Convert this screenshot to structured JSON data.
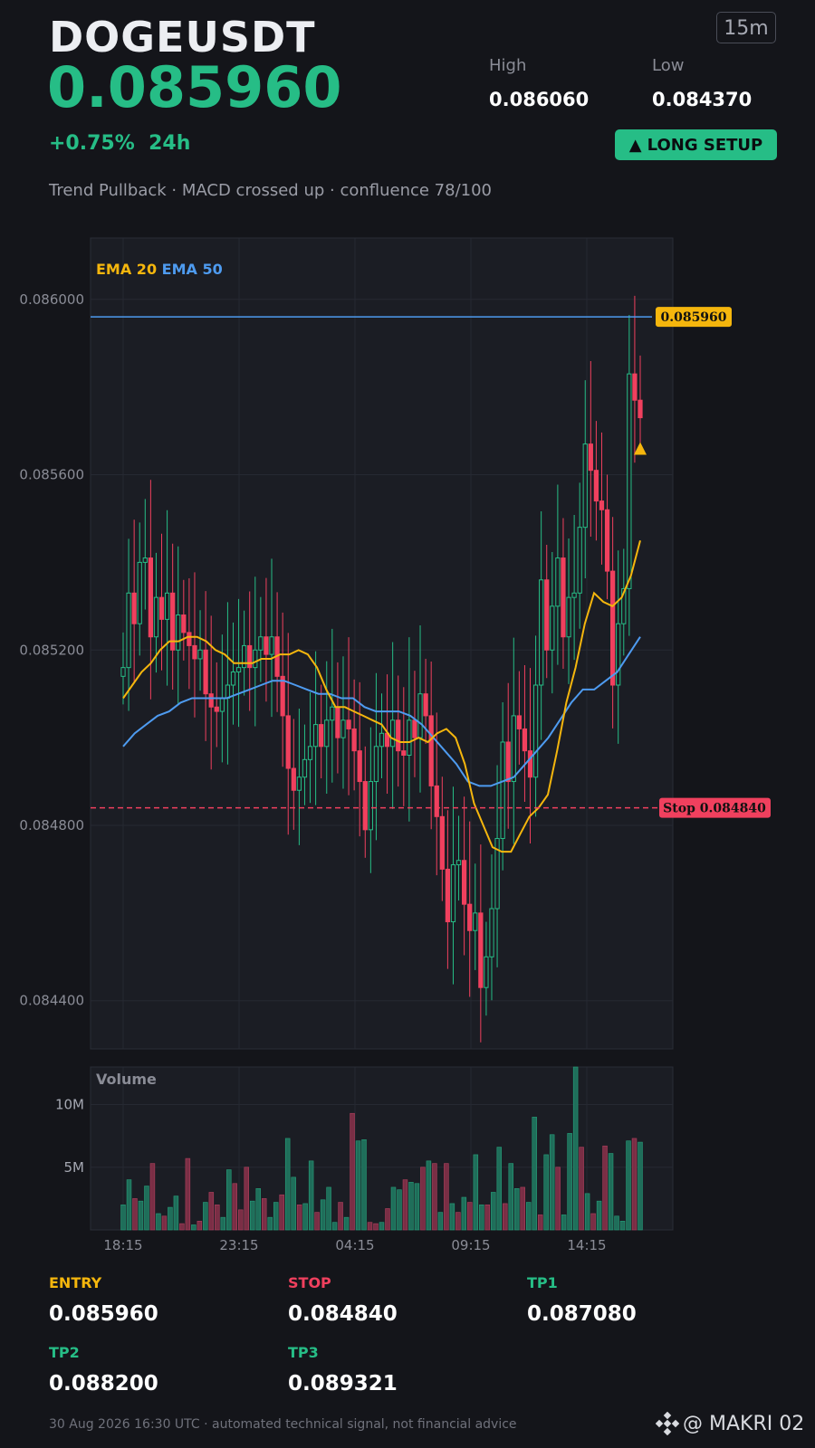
{
  "header": {
    "symbol": "DOGEUSDT",
    "price": "0.085960",
    "change": "+0.75%",
    "change_period": "24h",
    "subtitle": "Trend Pullback · MACD crossed up · confluence 78/100",
    "timeframe": "15m",
    "high_label": "High",
    "high_value": "0.086060",
    "low_label": "Low",
    "low_value": "0.084370",
    "setup_label": "LONG SETUP",
    "setup_icon": "triangle-up-icon"
  },
  "levels": {
    "entry_label": "ENTRY",
    "entry_value": "0.085960",
    "stop_label": "STOP",
    "stop_value": "0.084840",
    "tp1_label": "TP1",
    "tp1_value": "0.087080",
    "tp2_label": "TP2",
    "tp2_value": "0.088200",
    "tp3_label": "TP3",
    "tp3_value": "0.089321"
  },
  "footer": {
    "text": "30 Aug 2026 16:30 UTC  ·  automated technical signal, not financial advice",
    "brand": "@ MAKRI 02"
  },
  "colors": {
    "up": "#26bd86",
    "down": "#f0405e",
    "ema20": "#f5b60d",
    "ema50": "#4e9bf0",
    "entry": "#f5b60d",
    "stop": "#f0405e",
    "tp": "#26bd86"
  },
  "chart_data": [
    {
      "type": "candlestick",
      "title": "",
      "legend": [
        "EMA 20",
        "EMA 50"
      ],
      "x_ticks": [
        "18:15",
        "23:15",
        "04:15",
        "09:15",
        "14:15"
      ],
      "y_ticks": [
        "0.086000",
        "0.085600",
        "0.085200",
        "0.084800",
        "0.084400"
      ],
      "ylim": [
        0.08429,
        0.08614
      ],
      "grid": true,
      "last_price_label": "0.085960",
      "stop_label": "Stop 0.084840",
      "stop_level": 0.08484,
      "last_price": 0.08596,
      "candles_close": [
        0.08516,
        0.08533,
        0.08526,
        0.0854,
        0.08541,
        0.08523,
        0.08532,
        0.08527,
        0.08533,
        0.0852,
        0.08528,
        0.08524,
        0.08521,
        0.08518,
        0.0852,
        0.0851,
        0.08507,
        0.08506,
        0.08509,
        0.08512,
        0.08515,
        0.08516,
        0.08521,
        0.08516,
        0.0852,
        0.08523,
        0.08519,
        0.08523,
        0.08514,
        0.08505,
        0.08493,
        0.08488,
        0.08491,
        0.08495,
        0.08498,
        0.08503,
        0.08498,
        0.08504,
        0.08507,
        0.085,
        0.08504,
        0.08502,
        0.08497,
        0.0849,
        0.08479,
        0.0849,
        0.08498,
        0.08501,
        0.08498,
        0.08504,
        0.08497,
        0.08496,
        0.08504,
        0.085,
        0.0851,
        0.08505,
        0.08489,
        0.08482,
        0.0847,
        0.08458,
        0.08471,
        0.08472,
        0.08462,
        0.08456,
        0.0846,
        0.08443,
        0.0845,
        0.08461,
        0.08477,
        0.08499,
        0.0849,
        0.08505,
        0.08502,
        0.08497,
        0.08491,
        0.08512,
        0.08536,
        0.0852,
        0.0853,
        0.08541,
        0.08523,
        0.08532,
        0.08533,
        0.08548,
        0.08567,
        0.08561,
        0.08554,
        0.08552,
        0.08538,
        0.08512,
        0.08526,
        0.08534,
        0.08583,
        0.08577,
        0.08573
      ],
      "ema20": [
        0.08509,
        0.08512,
        0.08515,
        0.08517,
        0.0852,
        0.08522,
        0.08522,
        0.08523,
        0.08523,
        0.08522,
        0.0852,
        0.08519,
        0.08517,
        0.08517,
        0.08517,
        0.08518,
        0.08518,
        0.08519,
        0.08519,
        0.0852,
        0.08519,
        0.08516,
        0.08511,
        0.08507,
        0.08507,
        0.08506,
        0.08505,
        0.08504,
        0.08503,
        0.085,
        0.08499,
        0.08499,
        0.085,
        0.08499,
        0.08501,
        0.08502,
        0.085,
        0.08494,
        0.08485,
        0.0848,
        0.08475,
        0.08474,
        0.08474,
        0.08478,
        0.08482,
        0.08484,
        0.08487,
        0.08497,
        0.08508,
        0.08516,
        0.08526,
        0.08533,
        0.08531,
        0.0853,
        0.08532,
        0.08537,
        0.08545
      ],
      "ema50": [
        0.08498,
        0.08501,
        0.08503,
        0.08505,
        0.08506,
        0.08508,
        0.08509,
        0.08509,
        0.08509,
        0.08509,
        0.0851,
        0.08511,
        0.08512,
        0.08513,
        0.08513,
        0.08512,
        0.08511,
        0.0851,
        0.0851,
        0.08509,
        0.08509,
        0.08507,
        0.08506,
        0.08506,
        0.08506,
        0.08505,
        0.08503,
        0.085,
        0.08497,
        0.08494,
        0.0849,
        0.08489,
        0.08489,
        0.0849,
        0.08491,
        0.08494,
        0.08497,
        0.085,
        0.08504,
        0.08508,
        0.08511,
        0.08511,
        0.08513,
        0.08515,
        0.08519,
        0.08523
      ]
    },
    {
      "type": "bar",
      "title": "Volume",
      "y_ticks": [
        "10M",
        "5M"
      ],
      "x_ticks": [
        "18:15",
        "23:15",
        "04:15",
        "09:15",
        "14:15"
      ],
      "ylim": [
        0,
        13000000
      ],
      "values": [
        2.0,
        4.0,
        2.5,
        2.3,
        3.5,
        5.3,
        1.3,
        1.1,
        1.8,
        2.7,
        0.5,
        5.7,
        0.4,
        0.7,
        2.2,
        3.0,
        2.0,
        1.0,
        4.8,
        3.7,
        1.6,
        5.0,
        2.3,
        3.3,
        2.5,
        1.0,
        2.2,
        2.8,
        7.3,
        4.2,
        2.0,
        2.1,
        5.5,
        1.4,
        2.4,
        3.4,
        0.6,
        2.2,
        1.0,
        9.3,
        7.1,
        7.2,
        0.6,
        0.5,
        0.6,
        1.7,
        3.4,
        3.2,
        4.0,
        3.8,
        3.7,
        5.0,
        5.5,
        5.3,
        1.4,
        5.3,
        2.1,
        1.4,
        2.6,
        2.2,
        6.0,
        2.0,
        2.0,
        3.0,
        6.6,
        2.1,
        5.3,
        3.3,
        3.4,
        2.2,
        9.0,
        1.2,
        6.0,
        7.6,
        5.0,
        1.2,
        7.7,
        13.0,
        6.6,
        2.9,
        1.3,
        2.3,
        6.7,
        6.1,
        1.1,
        0.7,
        7.1,
        7.3,
        7.0
      ],
      "values_up": [
        1,
        1,
        0,
        1,
        1,
        0,
        1,
        0,
        1,
        1,
        0,
        0,
        1,
        0,
        1,
        0,
        0,
        1,
        1,
        0,
        0,
        0,
        1,
        1,
        0,
        1,
        1,
        0,
        1,
        1,
        0,
        1,
        1,
        0,
        1,
        1,
        1,
        0,
        1,
        0,
        1,
        1,
        0,
        0,
        1,
        0,
        1,
        1,
        0,
        1,
        1,
        0,
        1,
        0,
        1,
        0,
        1,
        0,
        1,
        0,
        1,
        1,
        0,
        1,
        1,
        0,
        1,
        1,
        0,
        1,
        1,
        0,
        1,
        1,
        0,
        1,
        1,
        1,
        0,
        1,
        0,
        1,
        0,
        1,
        1,
        1,
        1,
        0,
        1
      ]
    }
  ]
}
